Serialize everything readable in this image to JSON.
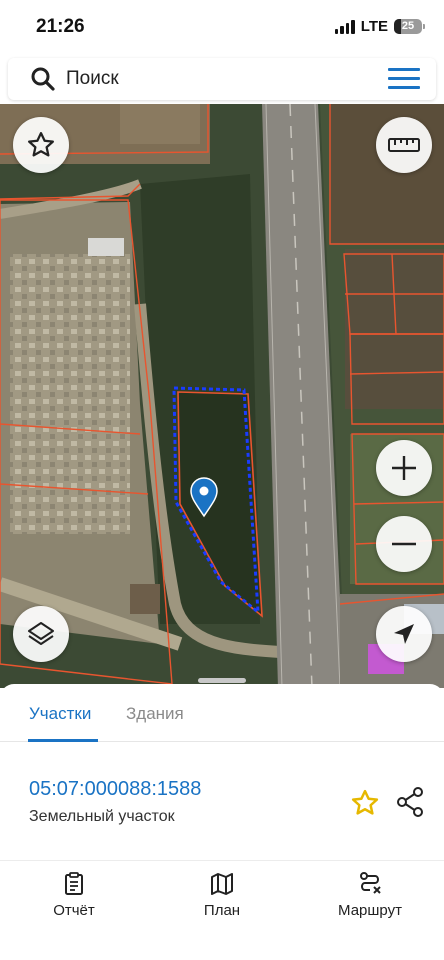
{
  "status_bar": {
    "time": "21:26",
    "network": "LTE",
    "battery_level": 25,
    "battery_text": "25"
  },
  "search": {
    "placeholder": "Поиск",
    "icon": "search-icon",
    "menu_icon": "hamburger-menu-icon"
  },
  "map": {
    "buttons": {
      "favorites": "star-icon",
      "ruler": "ruler-icon",
      "zoom_in": "plus-icon",
      "zoom_out": "minus-icon",
      "layers": "layers-icon",
      "locate": "navigation-arrow-icon"
    },
    "colors": {
      "parcel_outline": "#e8552f",
      "selected_outline": "#1a3cff",
      "marker": "#1a73c4"
    }
  },
  "sheet": {
    "tabs": [
      {
        "label": "Участки",
        "active": true
      },
      {
        "label": "Здания",
        "active": false
      }
    ],
    "parcel": {
      "number": "05:07:000088:1588",
      "type": "Земельный участок"
    }
  },
  "bottom_nav": {
    "items": [
      {
        "label": "Отчёт",
        "icon": "clipboard-icon"
      },
      {
        "label": "План",
        "icon": "map-icon"
      },
      {
        "label": "Маршрут",
        "icon": "route-icon"
      }
    ]
  },
  "colors": {
    "accent": "#1a73c4",
    "star": "#e6b800"
  }
}
